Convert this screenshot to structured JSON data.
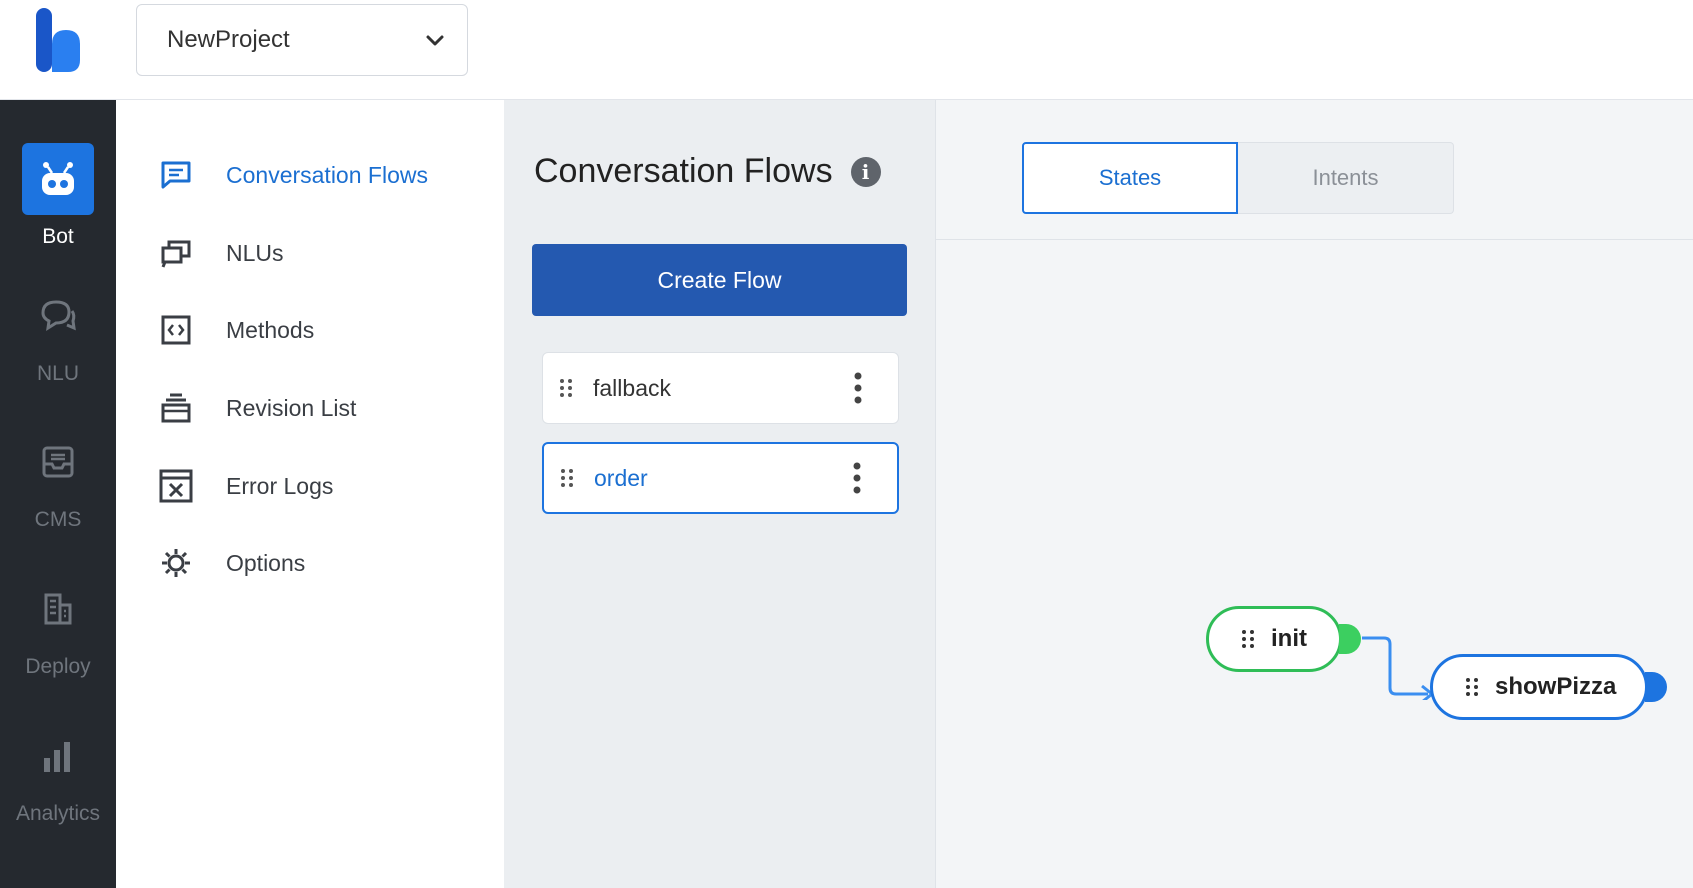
{
  "header": {
    "project_name": "NewProject",
    "logo_icon": "kommunicate-logo-icon"
  },
  "rail": {
    "items": [
      {
        "label": "Bot",
        "icon": "robot-icon",
        "active": true
      },
      {
        "label": "NLU",
        "icon": "chat-bubbles-icon"
      },
      {
        "label": "CMS",
        "icon": "inbox-icon"
      },
      {
        "label": "Deploy",
        "icon": "building-icon"
      },
      {
        "label": "Analytics",
        "icon": "bar-chart-icon"
      }
    ]
  },
  "subnav": {
    "items": [
      {
        "label": "Conversation Flows",
        "icon": "message-square-icon",
        "active": true
      },
      {
        "label": "NLUs",
        "icon": "stacked-messages-icon"
      },
      {
        "label": "Methods",
        "icon": "code-icon"
      },
      {
        "label": "Revision List",
        "icon": "layers-icon"
      },
      {
        "label": "Error Logs",
        "icon": "error-box-icon"
      },
      {
        "label": "Options",
        "icon": "gear-icon"
      }
    ]
  },
  "flows_panel": {
    "title": "Conversation Flows",
    "create_label": "Create Flow",
    "flows": [
      {
        "name": "fallback",
        "selected": false
      },
      {
        "name": "order",
        "selected": true
      }
    ]
  },
  "canvas": {
    "tabs": [
      {
        "label": "States",
        "active": true
      },
      {
        "label": "Intents",
        "active": false
      }
    ],
    "nodes": [
      {
        "label": "init",
        "color": "#2fbd57"
      },
      {
        "label": "showPizza",
        "color": "#1d74e0"
      }
    ]
  },
  "colors": {
    "accent": "#1d74e0",
    "primary_button": "#2459b0",
    "rail_bg": "#25292f",
    "init_green": "#2fbd57"
  }
}
